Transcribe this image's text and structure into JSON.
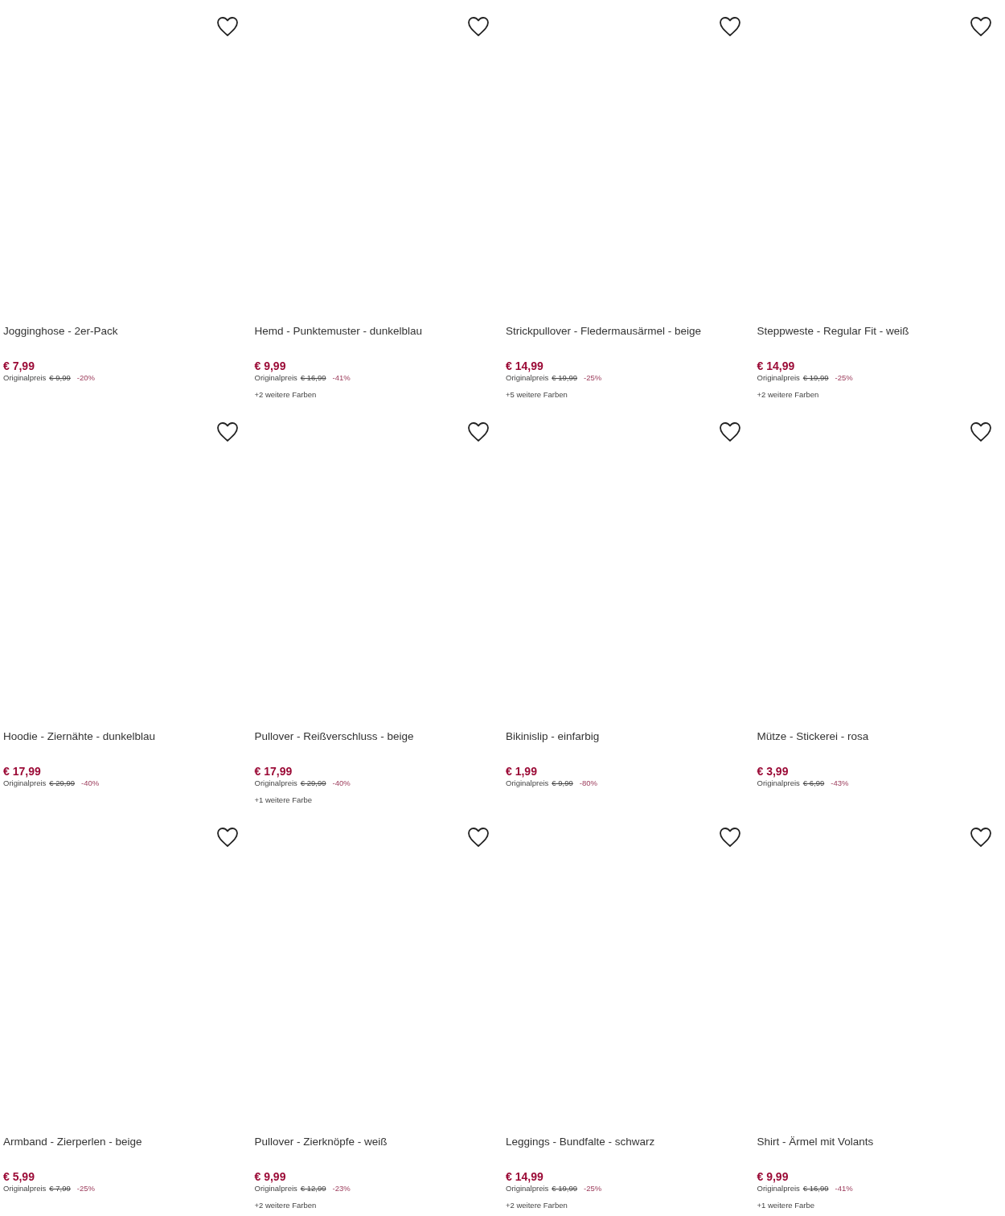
{
  "products": [
    {
      "title": "Jogginghose - 2er-Pack",
      "price": "€ 7,99",
      "original_label": "Originalpreis",
      "original_price": "€ 9,99",
      "discount": "-20%"
    },
    {
      "title": "Hemd - Punktemuster - dunkelblau",
      "price": "€ 9,99",
      "original_label": "Originalpreis",
      "original_price": "€ 16,99",
      "discount": "-41%",
      "more_colors": "+2 weitere Farben"
    },
    {
      "title": "Strickpullover - Fledermausärmel - beige",
      "price": "€ 14,99",
      "original_label": "Originalpreis",
      "original_price": "€ 19,99",
      "discount": "-25%",
      "more_colors": "+5 weitere Farben"
    },
    {
      "title": "Steppweste - Regular Fit - weiß",
      "price": "€ 14,99",
      "original_label": "Originalpreis",
      "original_price": "€ 19,99",
      "discount": "-25%",
      "more_colors": "+2 weitere Farben"
    },
    {
      "title": "Hoodie - Ziernähte - dunkelblau",
      "price": "€ 17,99",
      "original_label": "Originalpreis",
      "original_price": "€ 29,99",
      "discount": "-40%"
    },
    {
      "title": "Pullover - Reißverschluss - beige",
      "price": "€ 17,99",
      "original_label": "Originalpreis",
      "original_price": "€ 29,99",
      "discount": "-40%",
      "more_colors": "+1 weitere Farbe"
    },
    {
      "title": "Bikinislip - einfarbig",
      "price": "€ 1,99",
      "original_label": "Originalpreis",
      "original_price": "€ 9,99",
      "discount": "-80%"
    },
    {
      "title": "Mütze - Stickerei - rosa",
      "price": "€ 3,99",
      "original_label": "Originalpreis",
      "original_price": "€ 6,99",
      "discount": "-43%"
    },
    {
      "title": "Armband - Zierperlen - beige",
      "price": "€ 5,99",
      "original_label": "Originalpreis",
      "original_price": "€ 7,99",
      "discount": "-25%"
    },
    {
      "title": "Pullover - Zierknöpfe - weiß",
      "price": "€ 9,99",
      "original_label": "Originalpreis",
      "original_price": "€ 12,99",
      "discount": "-23%",
      "more_colors": "+2 weitere Farben"
    },
    {
      "title": "Leggings - Bundfalte - schwarz",
      "price": "€ 14,99",
      "original_label": "Originalpreis",
      "original_price": "€ 19,99",
      "discount": "-25%",
      "more_colors": "+2 weitere Farben"
    },
    {
      "title": "Shirt - Ärmel mit Volants",
      "price": "€ 9,99",
      "original_label": "Originalpreis",
      "original_price": "€ 16,99",
      "discount": "-41%",
      "more_colors": "+1 weitere Farbe"
    }
  ]
}
